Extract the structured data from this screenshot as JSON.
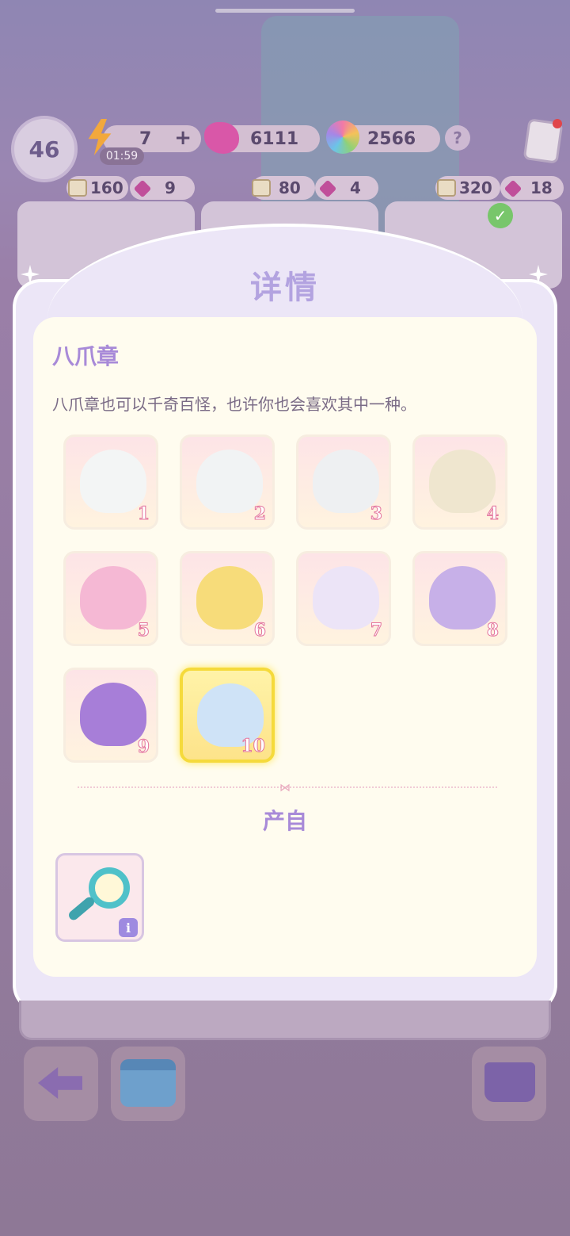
{
  "hud": {
    "level": "46",
    "energy": "7",
    "energy_plus": "+",
    "energy_timer": "01:59",
    "gems": "6111",
    "stars": "2566",
    "help": "?"
  },
  "orders": [
    {
      "book_cost": "160",
      "gem_cost": "9"
    },
    {
      "book_cost": "80",
      "gem_cost": "4"
    },
    {
      "book_cost": "320",
      "gem_cost": "18"
    }
  ],
  "modal": {
    "title": "详情",
    "item_name": "八爪章",
    "description": "八爪章也可以千奇百怪，也许你也会喜欢其中一种。",
    "source_label": "产自",
    "source_info": "i",
    "items": [
      {
        "level": "1",
        "color": "#f3f5f5"
      },
      {
        "level": "2",
        "color": "#f1f3f4"
      },
      {
        "level": "3",
        "color": "#eef0f2"
      },
      {
        "level": "4",
        "color": "#efe6cf"
      },
      {
        "level": "5",
        "color": "#f5b8d4"
      },
      {
        "level": "6",
        "color": "#f7dc7a"
      },
      {
        "level": "7",
        "color": "#ece4f7"
      },
      {
        "level": "8",
        "color": "#c7b0e8"
      },
      {
        "level": "9",
        "color": "#a77ed8"
      },
      {
        "level": "10",
        "color": "#cfe3f7"
      }
    ],
    "selected_level": "10"
  },
  "colors": {
    "accent_text": "#a88ad8",
    "title_text": "#b3a3e0",
    "selected_border": "#f5da3b"
  }
}
